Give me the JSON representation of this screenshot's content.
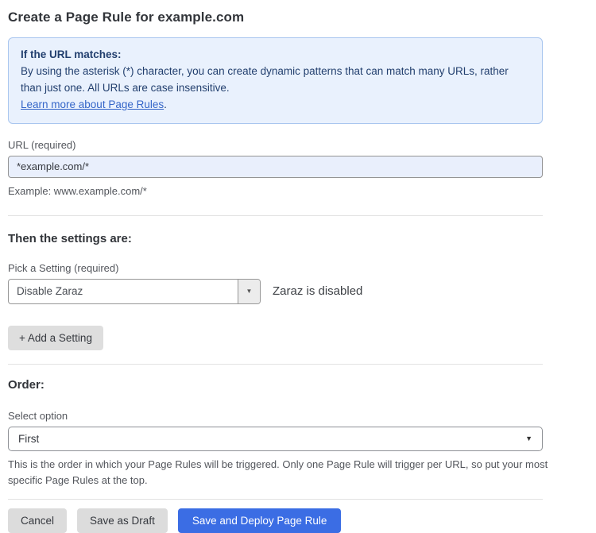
{
  "page": {
    "title": "Create a Page Rule for example.com"
  },
  "info_box": {
    "heading": "If the URL matches:",
    "body": "By using the asterisk (*) character, you can create dynamic patterns that can match many URLs, rather than just one. All URLs are case insensitive.",
    "link_label": "Learn more about Page Rules",
    "link_suffix": "."
  },
  "url_field": {
    "label": "URL (required)",
    "value": "*example.com/*",
    "helper": "Example: www.example.com/*"
  },
  "settings_section": {
    "heading": "Then the settings are:",
    "setting_label": "Pick a Setting (required)",
    "setting_value": "Disable Zaraz",
    "setting_status": "Zaraz is disabled",
    "add_setting_label": "+ Add a Setting"
  },
  "order_section": {
    "heading": "Order:",
    "select_label": "Select option",
    "select_value": "First",
    "helper": "This is the order in which your Page Rules will be triggered. Only one Page Rule will trigger per URL, so put your most specific Page Rules at the top."
  },
  "footer": {
    "cancel_label": "Cancel",
    "save_draft_label": "Save as Draft",
    "save_deploy_label": "Save and Deploy Page Rule"
  },
  "icons": {
    "setting_dropdown_caret": "▼",
    "order_select_caret": "▼"
  },
  "colors": {
    "info_bg": "#e9f1fd",
    "info_border": "#a9c6ef",
    "info_text": "#223f6e",
    "link_blue": "#3465c8",
    "input_bg": "#e9effc",
    "primary_button_blue": "#3b6de4",
    "gray_button": "#dcdcdc"
  }
}
